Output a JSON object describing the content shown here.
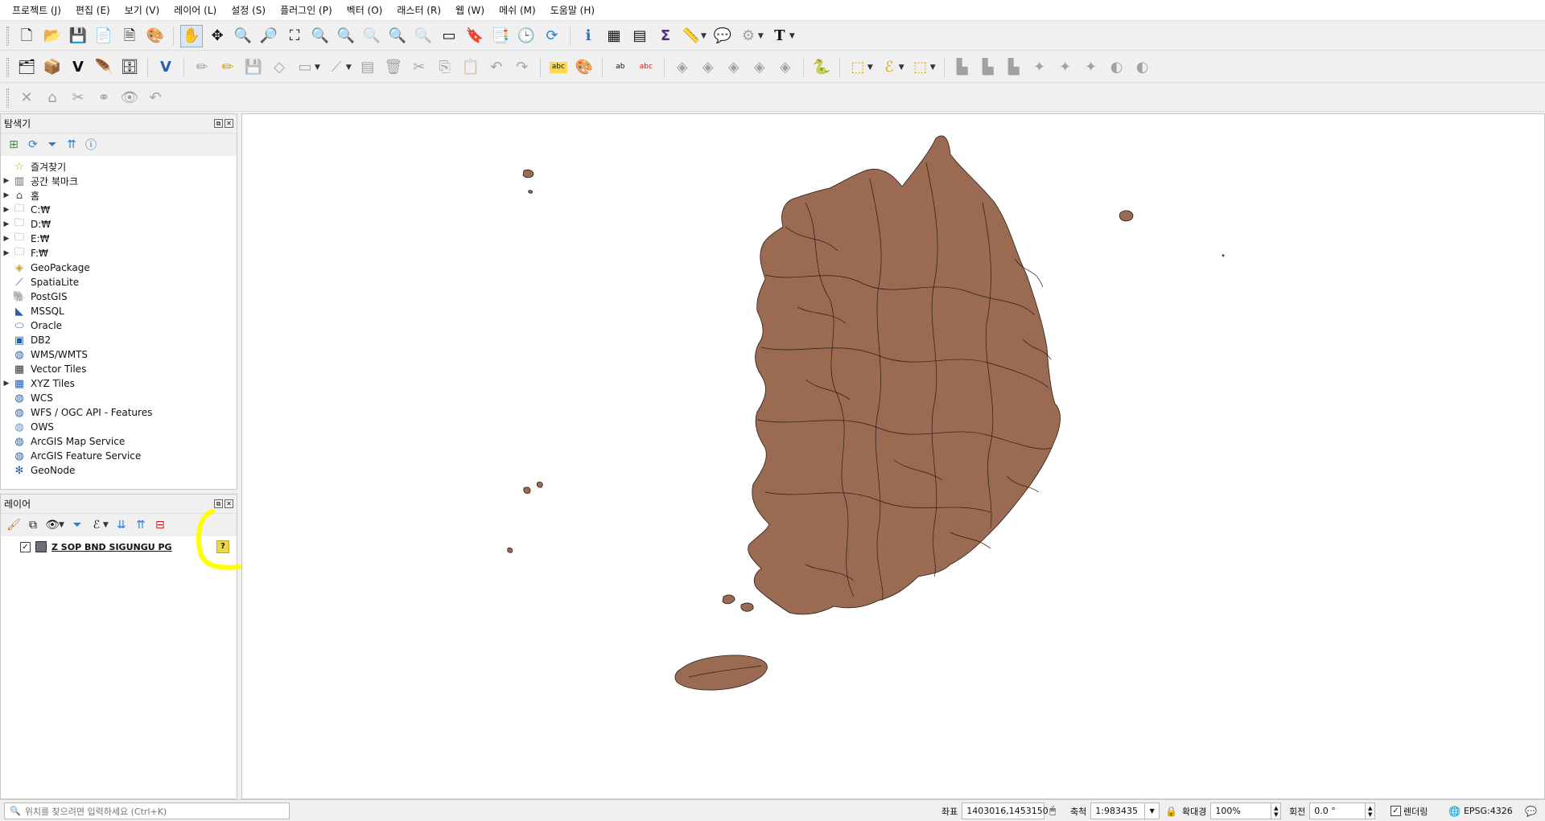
{
  "menu": [
    "프로젝트 (J)",
    "편집 (E)",
    "보기 (V)",
    "레이어 (L)",
    "설정 (S)",
    "플러그인 (P)",
    "벡터 (O)",
    "래스터 (R)",
    "웹 (W)",
    "메쉬 (M)",
    "도움말 (H)"
  ],
  "browser": {
    "title": "탐색기",
    "items": [
      {
        "label": "즐겨찾기",
        "expandable": false,
        "icon": "star-icon"
      },
      {
        "label": "공간 북마크",
        "expandable": true,
        "icon": "bookmark-icon"
      },
      {
        "label": "홈",
        "expandable": true,
        "icon": "home-folder-icon"
      },
      {
        "label": "C:₩",
        "expandable": true,
        "icon": "folder-icon"
      },
      {
        "label": "D:₩",
        "expandable": true,
        "icon": "folder-icon"
      },
      {
        "label": "E:₩",
        "expandable": true,
        "icon": "folder-icon"
      },
      {
        "label": "F:₩",
        "expandable": true,
        "icon": "folder-icon"
      },
      {
        "label": "GeoPackage",
        "expandable": false,
        "icon": "geopackage-icon"
      },
      {
        "label": "SpatiaLite",
        "expandable": false,
        "icon": "spatialite-icon"
      },
      {
        "label": "PostGIS",
        "expandable": false,
        "icon": "postgis-icon"
      },
      {
        "label": "MSSQL",
        "expandable": false,
        "icon": "mssql-icon"
      },
      {
        "label": "Oracle",
        "expandable": false,
        "icon": "oracle-icon"
      },
      {
        "label": "DB2",
        "expandable": false,
        "icon": "db2-icon"
      },
      {
        "label": "WMS/WMTS",
        "expandable": false,
        "icon": "wms-icon"
      },
      {
        "label": "Vector Tiles",
        "expandable": false,
        "icon": "vector-tiles-icon"
      },
      {
        "label": "XYZ Tiles",
        "expandable": true,
        "icon": "xyz-tiles-icon"
      },
      {
        "label": "WCS",
        "expandable": false,
        "icon": "wcs-icon"
      },
      {
        "label": "WFS / OGC API - Features",
        "expandable": false,
        "icon": "wfs-icon"
      },
      {
        "label": "OWS",
        "expandable": false,
        "icon": "ows-icon"
      },
      {
        "label": "ArcGIS Map Service",
        "expandable": false,
        "icon": "arcgis-map-icon"
      },
      {
        "label": "ArcGIS Feature Service",
        "expandable": false,
        "icon": "arcgis-feature-icon"
      },
      {
        "label": "GeoNode",
        "expandable": false,
        "icon": "geonode-icon"
      }
    ]
  },
  "layers": {
    "title": "레이어",
    "items": [
      {
        "label": "Z SOP BND SIGUNGU PG",
        "checked": true,
        "swatch": "#6b6e78",
        "warning": "?"
      }
    ]
  },
  "map": {
    "fill": "#9a6a52",
    "stroke": "#2a1c16"
  },
  "status": {
    "search_placeholder": "위치를 찾으려면 입력하세요 (Ctrl+K)",
    "coord_label": "좌표",
    "coord_value": "1403016,1453150",
    "scale_label": "축척",
    "scale_value": "1:983435",
    "magnifier_label": "확대경",
    "magnifier_value": "100%",
    "rotation_label": "회전",
    "rotation_value": "0.0 °",
    "render_label": "렌더링",
    "crs": "EPSG:4326"
  },
  "highlight_color": "#ffff00"
}
